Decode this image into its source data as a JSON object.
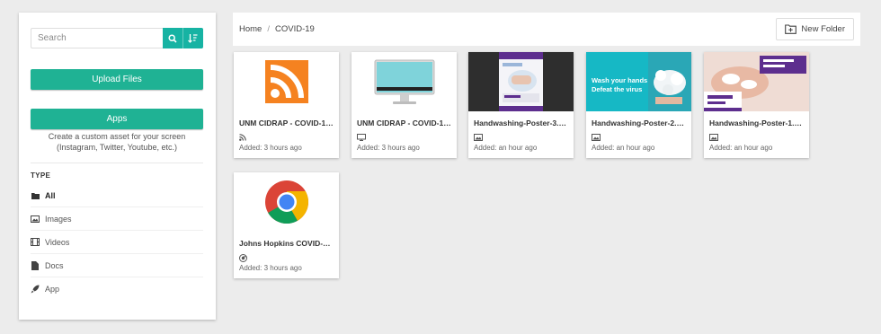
{
  "sidebar": {
    "search_placeholder": "Search",
    "search_icon": "search-icon",
    "sort_icon": "sort-icon",
    "upload_label": "Upload Files",
    "apps_label": "Apps",
    "apps_description": "Create a custom asset for your screen (Instagram, Twitter, Youtube, etc.)",
    "type_heading": "TYPE",
    "types": [
      {
        "label": "All",
        "icon": "folder-icon",
        "active": true
      },
      {
        "label": "Images",
        "icon": "image-icon"
      },
      {
        "label": "Videos",
        "icon": "film-icon"
      },
      {
        "label": "Docs",
        "icon": "document-icon"
      },
      {
        "label": "App",
        "icon": "rocket-icon"
      }
    ]
  },
  "breadcrumb": {
    "home": "Home",
    "separator": "/",
    "current": "COVID-19"
  },
  "toolbar": {
    "new_folder_label": "New Folder"
  },
  "cards": [
    {
      "title": "UNM CIDRAP - COVID-19 ...",
      "type_icon": "rss-icon",
      "added": "Added: 3 hours ago"
    },
    {
      "title": "UNM CIDRAP - COVID-19 ...",
      "type_icon": "monitor-icon",
      "added": "Added: 3 hours ago"
    },
    {
      "title": "Handwashing-Poster-3.png",
      "type_icon": "image-icon",
      "added": "Added: an hour ago"
    },
    {
      "title": "Handwashing-Poster-2.png",
      "type_icon": "image-icon",
      "added": "Added: an hour ago",
      "thumb_lines": [
        "Wash your hands",
        "Defeat the virus"
      ]
    },
    {
      "title": "Handwashing-Poster-1.png",
      "type_icon": "image-icon",
      "added": "Added: an hour ago"
    },
    {
      "title": "Johns Hopkins COVID-19...",
      "type_icon": "chrome-icon",
      "added": "Added: 3 hours ago"
    }
  ],
  "colors": {
    "accent": "#1fb294",
    "teal_button": "#17b3a3",
    "rss_orange": "#f58220",
    "poster_teal": "#16b8c5"
  }
}
